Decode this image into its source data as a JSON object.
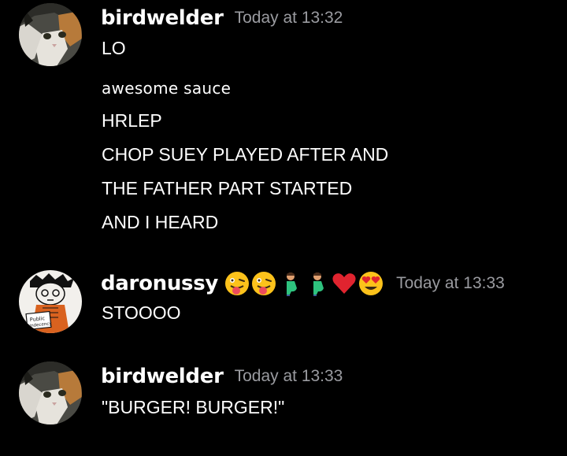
{
  "messages": [
    {
      "username": "birdwelder",
      "timestamp": "Today at 13:32",
      "avatar_icon": "cat-avatar",
      "lines": [
        "LO",
        "awesome sauce",
        "HRLEP",
        "CHOP SUEY PLAYED AFTER AND",
        "THE FATHER PART STARTED",
        "AND I HEARD"
      ]
    },
    {
      "username": "daronussy",
      "timestamp": "Today at 13:33",
      "avatar_icon": "drawing-avatar",
      "avatar_text": "Public indecency",
      "name_emojis": [
        "zany-face-emoji",
        "zany-face-emoji",
        "pregnant-man-emoji",
        "pregnant-man-emoji",
        "red-heart-emoji",
        "heart-eyes-emoji"
      ],
      "lines": [
        "STOOOO"
      ]
    },
    {
      "username": "birdwelder",
      "timestamp": "Today at 13:33",
      "avatar_icon": "cat-avatar",
      "lines": [
        "\"BURGER! BURGER!\""
      ]
    }
  ],
  "colors": {
    "background": "#000000",
    "username": "#ffffff",
    "timestamp": "#9a9ba0",
    "message_text": "#ffffff"
  }
}
